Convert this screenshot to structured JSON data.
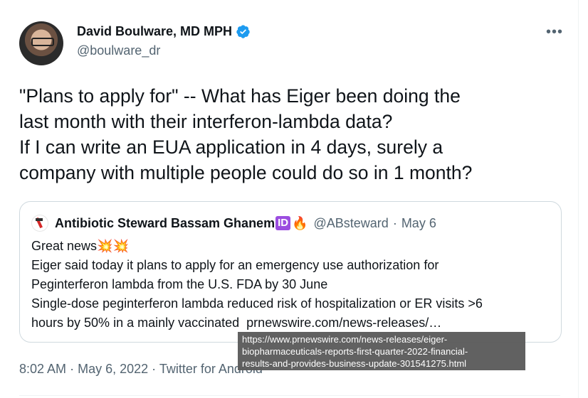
{
  "author": {
    "name": "David Boulware, MD MPH",
    "handle": "@boulware_dr",
    "verified": true
  },
  "icons": {
    "more": "•••"
  },
  "tweet": {
    "lines": [
      "\"Plans to apply for\" -- What has Eiger been doing the",
      "last month with their interferon-lambda data?",
      "If I can write an EUA application in 4 days, surely a",
      "company with multiple people could do so in 1 month?"
    ]
  },
  "quote": {
    "name": "Antibiotic Steward Bassam Ghanem",
    "badge": "ID",
    "emoji": "🔥",
    "handle": "@ABsteward",
    "sep": "·",
    "date": "May 6",
    "lines": [
      "Great news💥💥",
      "Eiger said today it plans to apply for an emergency use authorization for",
      "Peginterferon lambda from the U.S. FDA by 30 June",
      "Single-dose peginterferon lambda reduced risk of hospitalization or ER visits >6"
    ],
    "last_line_prefix": "hours by 50% in a mainly vaccinated  ",
    "link_text": "prnewswire.com/news-releases/…"
  },
  "meta": {
    "time": "8:02 AM",
    "sep": "·",
    "date": "May 6, 2022",
    "source": "Twitter for Android"
  },
  "tooltip": {
    "lines": [
      "https://www.prnewswire.com/news-releases/eiger-",
      "biopharmaceuticals-reports-first-quarter-2022-financial-",
      "results-and-provides-business-update-301541275.html"
    ]
  },
  "colors": {
    "verified": "#1d9bf0",
    "secondary_text": "#536471",
    "id_badge": "#9b4de0",
    "tooltip_bg": "#5b5b5b"
  }
}
